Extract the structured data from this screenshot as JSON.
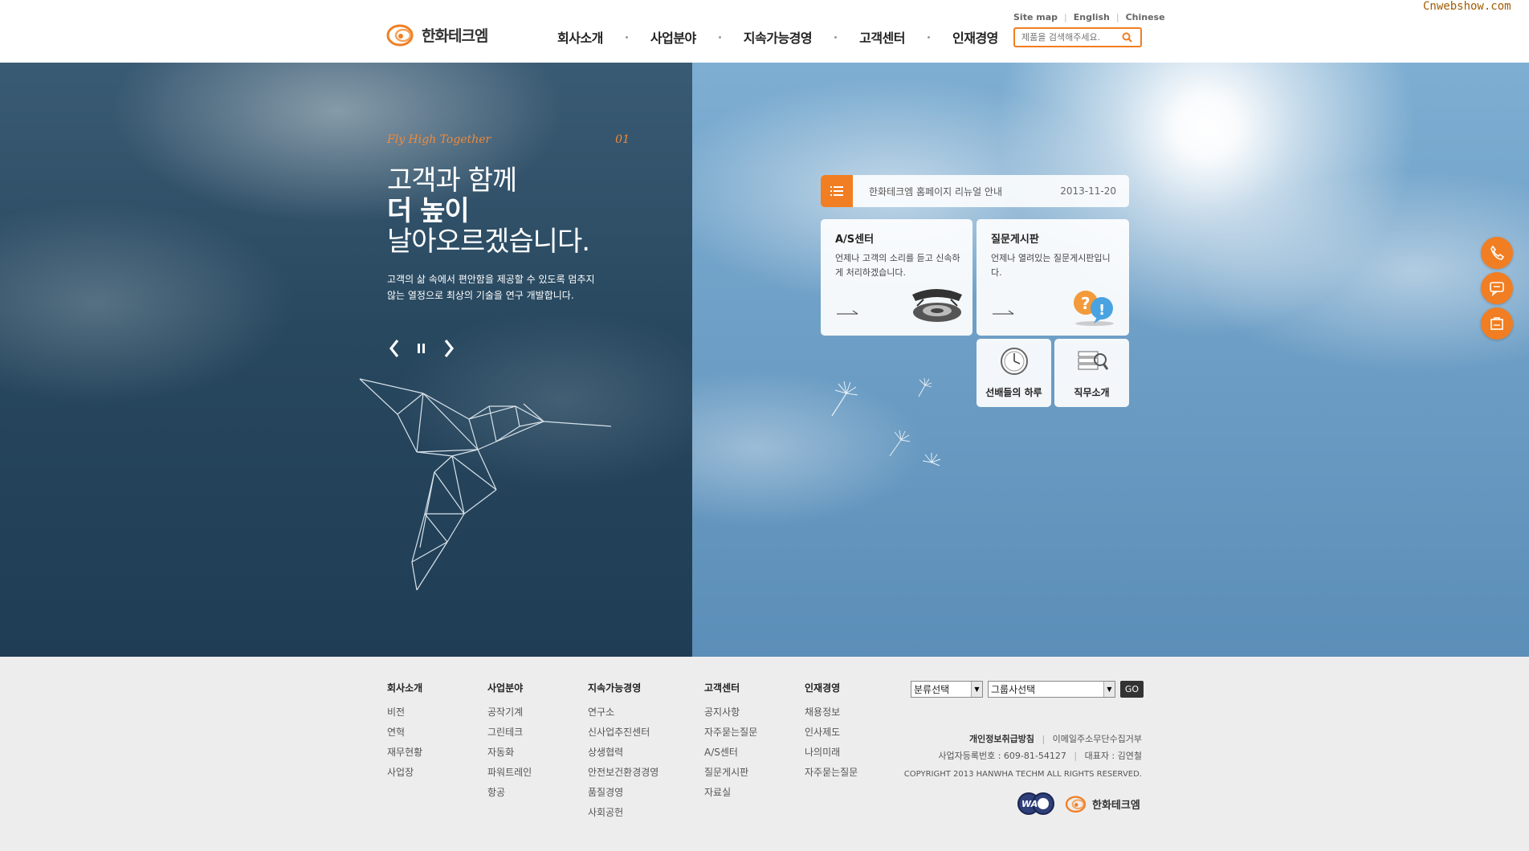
{
  "watermark": "Cnwebshow.com",
  "header": {
    "logo_text": "한화테크엠",
    "nav": [
      "회사소개",
      "사업분야",
      "지속가능경영",
      "고객센터",
      "인재경영"
    ],
    "util": [
      "Site map",
      "English",
      "Chinese"
    ],
    "search_placeholder": "제품을 검색해주세요."
  },
  "hero": {
    "tagline": "Fly High Together",
    "slide_no": "01",
    "headline": [
      "고객과 함께",
      "더 높이",
      "날아오르겠습니다."
    ],
    "desc": [
      "고객의 삶 속에서 편안함을 제공할 수 있도록 멈추지",
      "않는 열정으로 최상의 기술을 연구 개발합니다."
    ]
  },
  "notice": {
    "title": "한화테크엠 홈페이지 리뉴얼 안내",
    "date": "2013-11-20"
  },
  "cards": {
    "as": {
      "title": "A/S센터",
      "desc": "언제나 고객의 소리를 듣고 신속하게 처리하겠습니다."
    },
    "qna": {
      "title": "질문게시판",
      "desc": "언제나 열려있는 질문게시판입니다."
    },
    "day": {
      "label": "선배들의 하루"
    },
    "job": {
      "label": "직무소개"
    }
  },
  "colors": {
    "accent": "#f17e22"
  },
  "footer": {
    "columns": [
      {
        "title": "회사소개",
        "items": [
          "비전",
          "연혁",
          "재무현황",
          "사업장"
        ]
      },
      {
        "title": "사업분야",
        "items": [
          "공작기계",
          "그린테크",
          "자동화",
          "파워트레인",
          "항공"
        ]
      },
      {
        "title": "지속가능경영",
        "items": [
          "연구소",
          "신사업추진센터",
          "상생협력",
          "안전보건환경경영",
          "품질경영",
          "사회공헌"
        ]
      },
      {
        "title": "고객센터",
        "items": [
          "공지사항",
          "자주묻는질문",
          "A/S센터",
          "질문게시판",
          "자료실"
        ]
      },
      {
        "title": "인재경영",
        "items": [
          "채용정보",
          "인사제도",
          "나의미래",
          "자주묻는질문"
        ]
      }
    ],
    "select1": "분류선택",
    "select2": "그룹사선택",
    "go": "GO",
    "privacy": "개인정보취급방침",
    "email_policy": "이메일주소무단수집거부",
    "biz_no": "사업자등록번호 : 609-81-54127",
    "ceo": "대표자 : 김연철",
    "copyright": "COPYRIGHT 2013 HANWHA TECHM ALL RIGHTS RESERVED.",
    "logo_text": "한화테크엠",
    "badge_text": "WA"
  }
}
